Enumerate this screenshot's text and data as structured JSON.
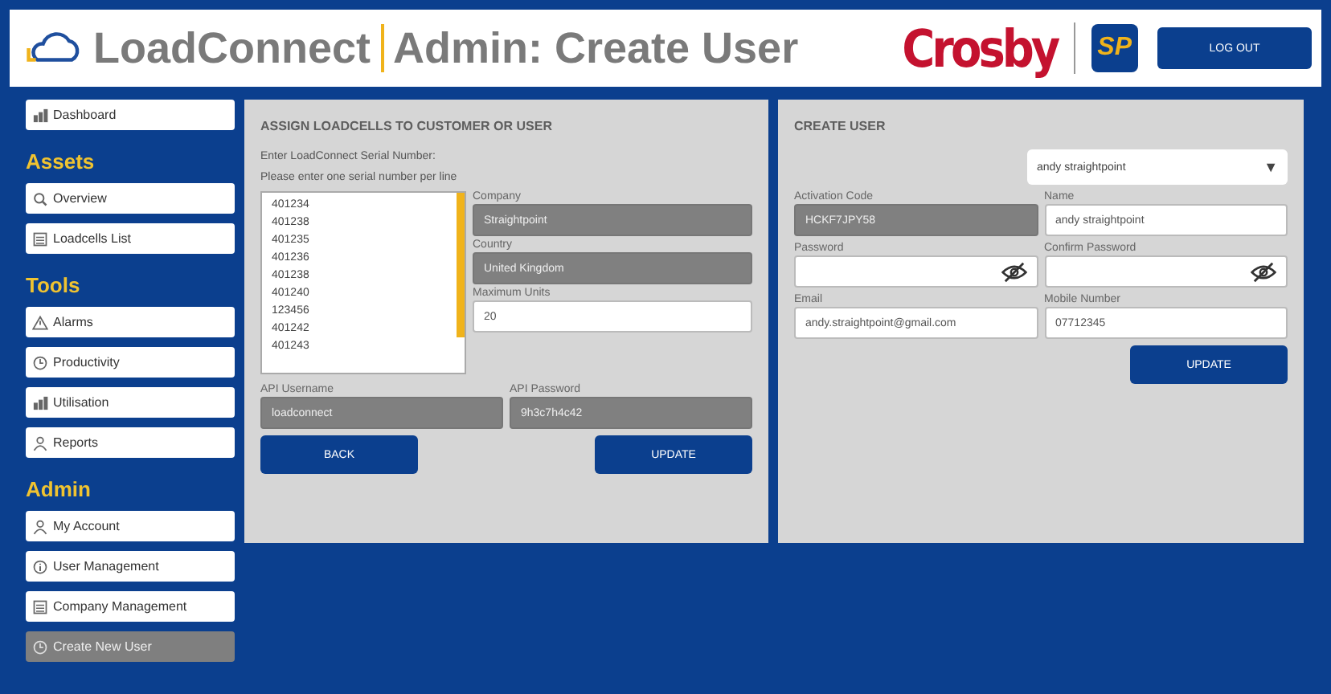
{
  "header": {
    "app_name": "LoadConnect",
    "page_title": "Admin: Create User",
    "brand": "Crosby",
    "brand_badge": "SP",
    "logout_button": "LOG OUT"
  },
  "sidebar": {
    "sections": [
      {
        "items": [
          {
            "label": "Dashboard",
            "selected": false
          }
        ]
      },
      {
        "heading": "Assets",
        "items": [
          {
            "label": "Overview",
            "selected": false
          },
          {
            "label": "Loadcells List",
            "selected": false
          }
        ]
      },
      {
        "heading": "Tools",
        "items": [
          {
            "label": "Alarms",
            "selected": false
          },
          {
            "label": "Productivity",
            "selected": false
          },
          {
            "label": "Utilisation",
            "selected": false
          },
          {
            "label": "Reports",
            "selected": false
          }
        ]
      },
      {
        "heading": "Admin",
        "items": [
          {
            "label": "My Account",
            "selected": false
          },
          {
            "label": "User Management",
            "selected": false
          },
          {
            "label": "Company Management",
            "selected": false
          },
          {
            "label": "Create New User",
            "selected": true
          }
        ]
      }
    ]
  },
  "assign_panel": {
    "title": "ASSIGN LOADCELLS TO CUSTOMER OR USER",
    "instructions": [
      "Enter LoadConnect Serial Number:",
      "Please enter one serial number per line"
    ],
    "serials": [
      "401234",
      "401238",
      "401235",
      "401236",
      "401238",
      "401240",
      "123456",
      "401242",
      "401243"
    ],
    "fields": [
      {
        "label": "Company",
        "value": "Straightpoint",
        "kind": "readonly"
      },
      {
        "label": "Country",
        "value": "United Kingdom",
        "kind": "readonly"
      },
      {
        "label": "Maximum Units",
        "value": "20",
        "kind": "input"
      }
    ],
    "api_fields": [
      {
        "label": "API Username",
        "value": "loadconnect",
        "kind": "readonly"
      },
      {
        "label": "API Password",
        "value": "9h3c7h4c42",
        "kind": "readonly"
      }
    ],
    "buttons": [
      "BACK",
      "UPDATE"
    ]
  },
  "user_panel": {
    "title": "CREATE USER",
    "user_select": "andy straightpoint",
    "caret": "▼",
    "fields": [
      {
        "label": "Activation Code",
        "value": "HCKF7JPY58",
        "kind": "readonly"
      },
      {
        "label": "Name",
        "value": "andy straightpoint",
        "kind": "input"
      },
      {
        "label": "Password",
        "kind": "password"
      },
      {
        "label": "Confirm Password",
        "kind": "password"
      },
      {
        "label": "Email",
        "value": "andy.straightpoint@gmail.com",
        "kind": "input"
      },
      {
        "label": "Mobile Number",
        "value": "07712345",
        "kind": "input"
      }
    ],
    "button": "UPDATE"
  }
}
